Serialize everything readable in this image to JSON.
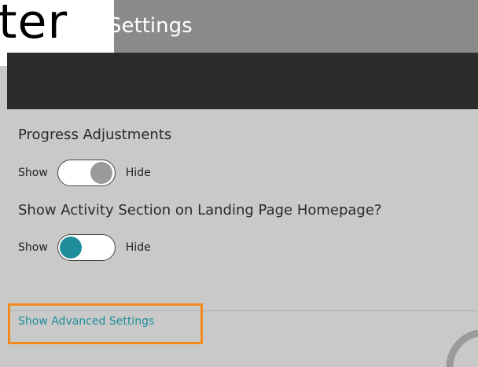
{
  "header": {
    "logo_fragment": "ter",
    "title": "Settings"
  },
  "settings": [
    {
      "label": "Progress Adjustments",
      "show_label": "Show",
      "hide_label": "Hide",
      "state": "hide"
    },
    {
      "label": "Show Activity Section on Landing Page Homepage?",
      "show_label": "Show",
      "hide_label": "Hide",
      "state": "show"
    }
  ],
  "advanced": {
    "link_label": "Show Advanced Settings",
    "highlight_color": "#f28b1c"
  },
  "colors": {
    "accent": "#1f8e9a",
    "header_bg": "#8a8a8a",
    "dark_band": "#2b2b2b",
    "panel_bg": "#c9c9c9"
  }
}
